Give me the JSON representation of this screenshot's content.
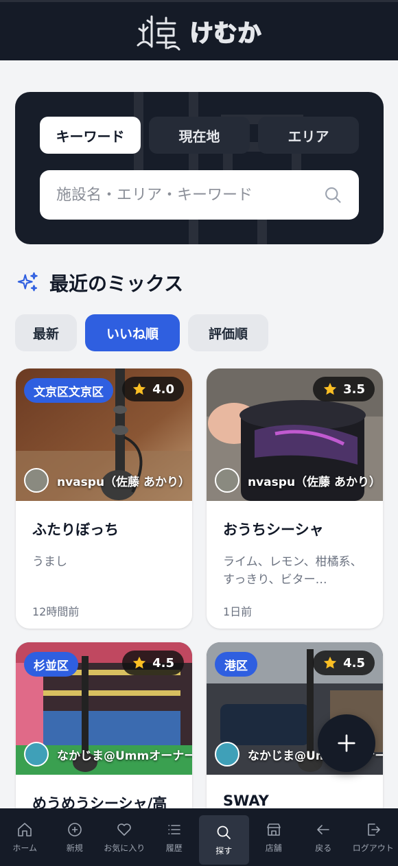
{
  "header": {
    "logo_text": "けむか",
    "logo_icon": "hookah-logo-icon"
  },
  "search": {
    "modes": [
      "キーワード",
      "現在地",
      "エリア"
    ],
    "active_mode": "キーワード",
    "placeholder": "施設名・エリア・キーワード",
    "value": ""
  },
  "section": {
    "title": "最近のミックス",
    "icon": "sparkles-icon"
  },
  "sort": {
    "options": [
      "最新",
      "いいね順",
      "評価順"
    ],
    "active": "いいね順"
  },
  "cards": [
    {
      "area": "文京区文京区",
      "rating": "4.0",
      "author": "nvaspu（佐藤 あかり）",
      "title": "ふたりぼっち",
      "description": "うまし",
      "time": "12時間前"
    },
    {
      "area": "",
      "rating": "3.5",
      "author": "nvaspu（佐藤 あかり）",
      "title": "おうちシーシャ",
      "description": "ライム、レモン、柑橘系、すっきり、ビター…",
      "time": "1日前"
    },
    {
      "area": "杉並区",
      "rating": "4.5",
      "author": "なかじま@Ummオーナー",
      "title": "めうめうシーシャ/高",
      "description": "",
      "time": ""
    },
    {
      "area": "港区",
      "rating": "4.5",
      "author": "なかじま@Ummオーナー",
      "title": "SWAY",
      "description": "",
      "time": ""
    }
  ],
  "fab": {
    "icon": "plus-icon"
  },
  "nav": [
    {
      "label": "ホーム",
      "icon": "home-icon"
    },
    {
      "label": "新規",
      "icon": "plus-circle-icon"
    },
    {
      "label": "お気に入り",
      "icon": "heart-icon"
    },
    {
      "label": "履歴",
      "icon": "list-icon"
    },
    {
      "label": "探す",
      "icon": "search-icon"
    },
    {
      "label": "店舗",
      "icon": "store-icon"
    },
    {
      "label": "戻る",
      "icon": "arrow-left-icon"
    },
    {
      "label": "ログアウト",
      "icon": "logout-icon"
    }
  ],
  "nav_active": "探す",
  "colors": {
    "header_bg": "#151b27",
    "accent": "#2f5fe0",
    "page_bg": "#f3f4f6"
  }
}
